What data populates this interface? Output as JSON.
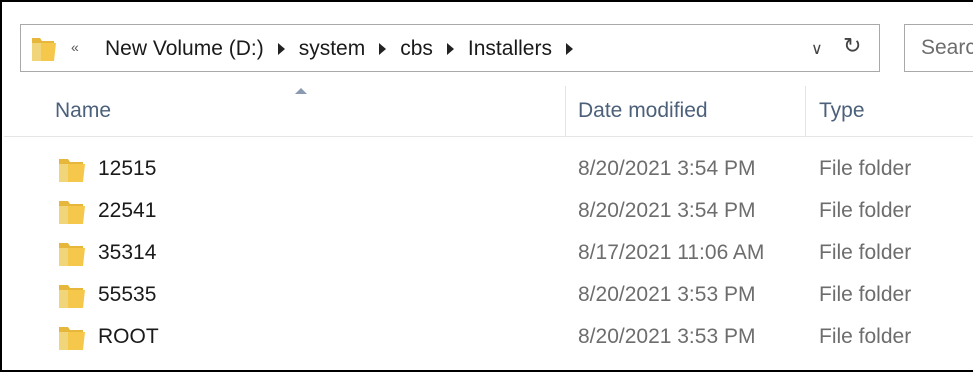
{
  "address_bar": {
    "overflow_chevron": "«",
    "crumbs": [
      "New Volume (D:)",
      "system",
      "cbs",
      "Installers"
    ],
    "dropdown_icon": "chevron-down-icon",
    "refresh_icon": "refresh-icon"
  },
  "search": {
    "placeholder": "Search"
  },
  "columns": {
    "name": "Name",
    "date_modified": "Date modified",
    "type": "Type"
  },
  "files": [
    {
      "name": "12515",
      "date_modified": "8/20/2021 3:54 PM",
      "type": "File folder"
    },
    {
      "name": "22541",
      "date_modified": "8/20/2021 3:54 PM",
      "type": "File folder"
    },
    {
      "name": "35314",
      "date_modified": "8/17/2021 11:06 AM",
      "type": "File folder"
    },
    {
      "name": "55535",
      "date_modified": "8/20/2021 3:53 PM",
      "type": "File folder"
    },
    {
      "name": "ROOT",
      "date_modified": "8/20/2021 3:53 PM",
      "type": "File folder"
    }
  ],
  "colors": {
    "header_text": "#4c607a",
    "folder_yellow": "#f5c84c",
    "detail_text": "#6d6d6d"
  }
}
